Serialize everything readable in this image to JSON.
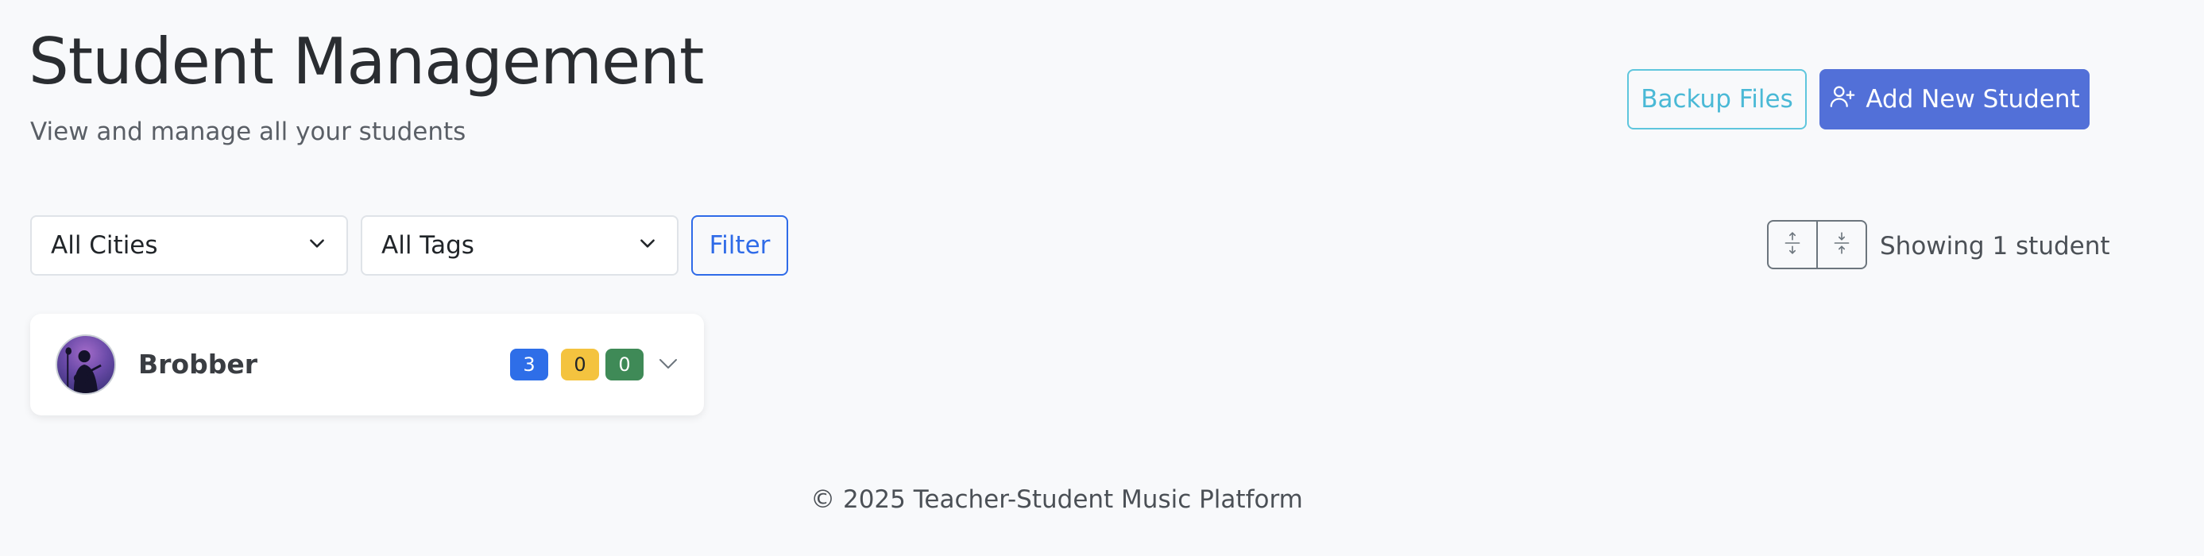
{
  "header": {
    "title": "Student Management",
    "subtitle": "View and manage all your students"
  },
  "actions": {
    "backup_label": "Backup Files",
    "add_label": "Add New Student",
    "add_icon": "user-plus-icon"
  },
  "filters": {
    "city_selected": "All Cities",
    "tags_selected": "All Tags",
    "filter_label": "Filter"
  },
  "view_controls": {
    "expand_icon": "expand-all-icon",
    "collapse_icon": "collapse-all-icon",
    "showing_text": "Showing 1 student"
  },
  "students": [
    {
      "name": "Brobber",
      "badges": [
        "3",
        "0",
        "0"
      ],
      "badge_colors": [
        "#2e6ee8",
        "#f4c33f",
        "#3f8a57"
      ]
    }
  ],
  "footer": {
    "text": "© 2025 Teacher-Student Music Platform"
  },
  "colors": {
    "primary": "#5270d8",
    "info": "#4ab9d6",
    "filter_blue": "#2f6be8",
    "background": "#f8f9fb"
  }
}
